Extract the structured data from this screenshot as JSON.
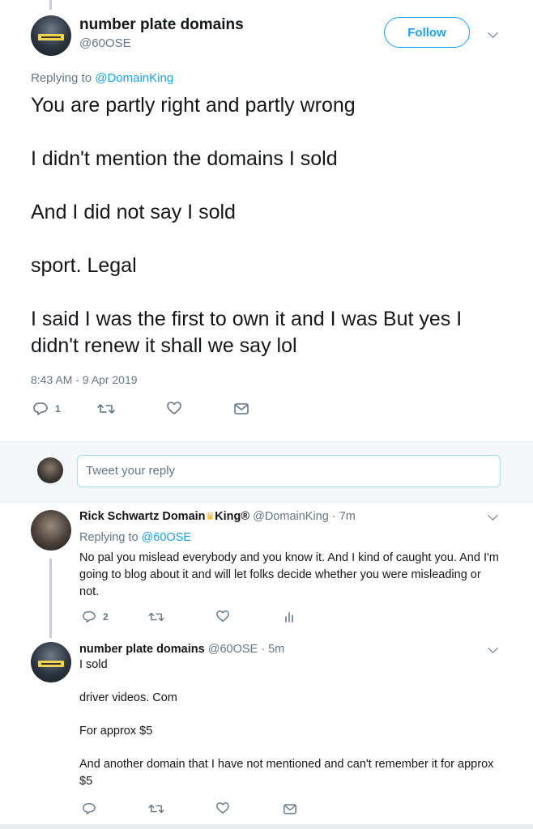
{
  "main_tweet": {
    "display_name": "number plate domains",
    "handle": "@60OSE",
    "follow_label": "Follow",
    "replying_prefix": "Replying to",
    "replying_to": "@DomainKing",
    "lines": [
      "You are partly right and partly wrong",
      "I didn't mention the domains I sold",
      "And I did not say I sold",
      "sport. Legal",
      "I said I was the first to own it and I was But yes I didn't renew it shall we say lol"
    ],
    "timestamp": "8:43 AM - 9 Apr 2019",
    "reply_count": "1"
  },
  "compose": {
    "placeholder": "Tweet your reply"
  },
  "replies": [
    {
      "display_name_a": "Rick Schwartz Domain",
      "display_name_b": "King®",
      "handle_time": "@DomainKing · 7m",
      "replying_prefix": "Replying to",
      "replying_to": "@60OSE",
      "text": "No pal you mislead everybody and you know it. And I kind of caught you. And I'm going to blog about it and will let folks decide whether you were misleading or not.",
      "reply_count": "2"
    },
    {
      "display_name": "number plate domains",
      "handle_time": "@60OSE · 5m",
      "paragraphs": [
        "I sold",
        "driver videos. Com",
        "For approx $5",
        "And another domain that I have not mentioned and can't remember it for approx $5"
      ]
    }
  ],
  "colors": {
    "accent": "#1da1f2",
    "muted": "#657786",
    "text": "#14171a"
  },
  "icons": [
    "reply-icon",
    "retweet-icon",
    "like-icon",
    "dm-icon",
    "analytics-icon",
    "chevron-down-icon",
    "crown-icon"
  ]
}
